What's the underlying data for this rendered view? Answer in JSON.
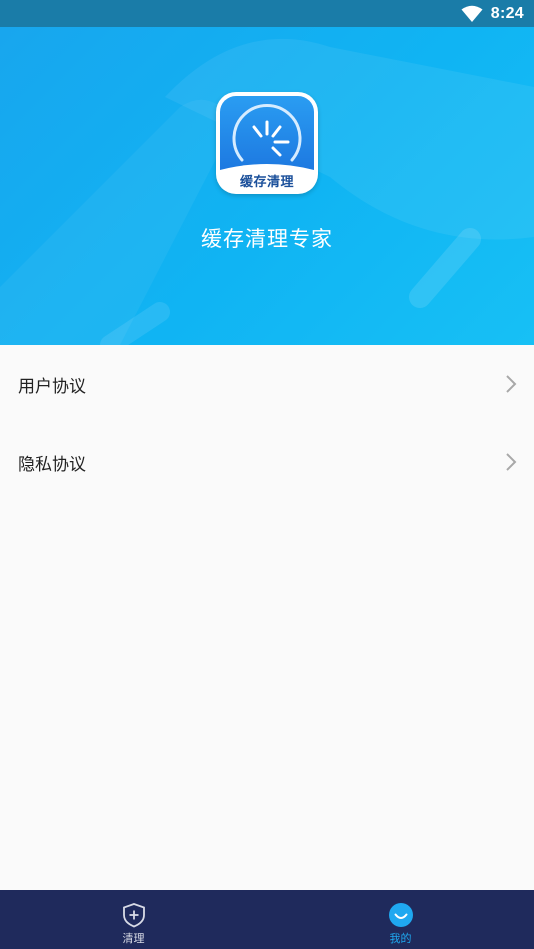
{
  "status_bar": {
    "time": "8:24",
    "wifi_icon": "wifi-icon"
  },
  "header": {
    "app_icon_label": "缓存清理",
    "app_title": "缓存清理专家",
    "background_color": "#10b4f3"
  },
  "menu": {
    "items": [
      {
        "label": "用户协议",
        "icon": "chevron-right-icon"
      },
      {
        "label": "隐私协议",
        "icon": "chevron-right-icon"
      }
    ]
  },
  "bottom_nav": {
    "background_color": "#1f2a5c",
    "active_color": "#1fa8f0",
    "tabs": [
      {
        "label": "清理",
        "icon": "shield-plus-icon",
        "active": false
      },
      {
        "label": "我的",
        "icon": "smile-icon",
        "active": true
      }
    ]
  }
}
